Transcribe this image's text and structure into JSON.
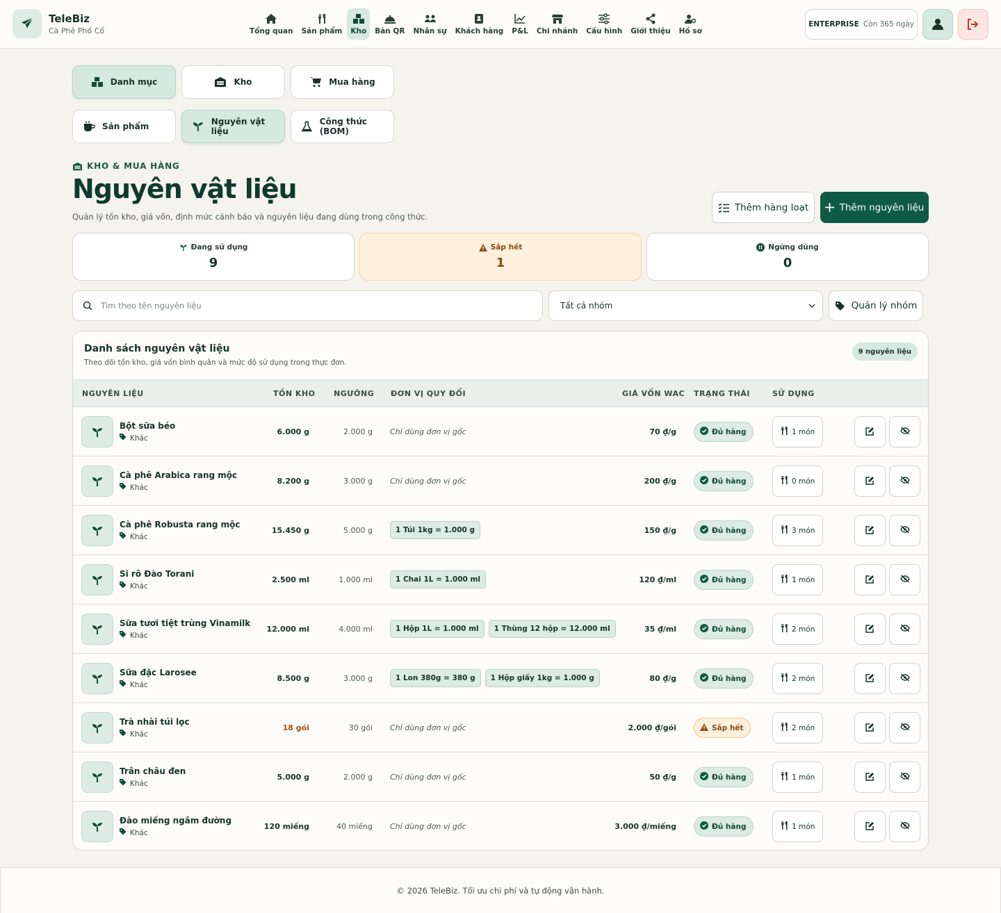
{
  "brand": {
    "name": "TeleBiz",
    "store": "Cà Phê Phố Cổ"
  },
  "nav": [
    {
      "label": "Tổng quan",
      "icon": "home-icon"
    },
    {
      "label": "Sản phẩm",
      "icon": "utensils-icon"
    },
    {
      "label": "Kho",
      "icon": "boxes-icon",
      "active": true
    },
    {
      "label": "Bàn QR",
      "icon": "cloche-icon"
    },
    {
      "label": "Nhân sự",
      "icon": "users-icon"
    },
    {
      "label": "Khách hàng",
      "icon": "contact-book-icon"
    },
    {
      "label": "P&L",
      "icon": "line-chart-icon"
    },
    {
      "label": "Chi nhánh",
      "icon": "store-icon"
    },
    {
      "label": "Cấu hình",
      "icon": "sliders-icon"
    },
    {
      "label": "Giới thiệu",
      "icon": "share-icon"
    },
    {
      "label": "Hồ sơ",
      "icon": "user-cog-icon"
    }
  ],
  "plan": {
    "name": "ENTERPRISE",
    "days": "Còn 365 ngày"
  },
  "tabs_main": [
    {
      "label": "Danh mục",
      "active": true
    },
    {
      "label": "Kho"
    },
    {
      "label": "Mua hàng"
    }
  ],
  "tabs_sub": [
    {
      "label": "Sản phẩm"
    },
    {
      "label": "Nguyên vật liệu",
      "active": true
    },
    {
      "label": "Công thức (BOM)"
    }
  ],
  "page": {
    "eyebrow": "KHO & MUA HÀNG",
    "title": "Nguyên vật liệu",
    "description": "Quản lý tồn kho, giá vốn, định mức cảnh báo và nguyên liệu đang dùng trong công thức.",
    "bulk_add_label": "Thêm hàng loạt",
    "add_label": "Thêm nguyên liệu"
  },
  "stats": [
    {
      "label": "Đang sử dụng",
      "value": "9"
    },
    {
      "label": "Sắp hết",
      "value": "1"
    },
    {
      "label": "Ngừng dùng",
      "value": "0"
    }
  ],
  "filters": {
    "search_placeholder": "Tìm theo tên nguyên liệu",
    "group_selected": "Tất cả nhóm",
    "manage_groups_label": "Quản lý nhóm"
  },
  "table": {
    "title": "Danh sách nguyên vật liệu",
    "subtitle": "Theo dõi tồn kho, giá vốn bình quân và mức độ sử dụng trong thực đơn.",
    "count_badge": "9 nguyên liệu",
    "headers": {
      "material": "NGUYÊN LIỆU",
      "stock": "TỒN KHO",
      "threshold": "NGƯỠNG",
      "conversion": "ĐƠN VỊ QUY ĐỔI",
      "cost": "GIÁ VỐN WAC",
      "status": "TRẠNG THÁI",
      "usage": "SỬ DỤNG"
    },
    "rows": [
      {
        "name": "Bột sữa béo",
        "group": "Khác",
        "stock": "6.000 g",
        "threshold": "2.000 g",
        "conversions": [],
        "no_conversion": "Chỉ dùng đơn vị gốc",
        "cost": "70 ₫/g",
        "status": "Đủ hàng",
        "status_type": "ok",
        "usage": "1 món"
      },
      {
        "name": "Cà phê Arabica rang mộc",
        "group": "Khác",
        "stock": "8.200 g",
        "threshold": "3.000 g",
        "conversions": [],
        "no_conversion": "Chỉ dùng đơn vị gốc",
        "cost": "200 ₫/g",
        "status": "Đủ hàng",
        "status_type": "ok",
        "usage": "0 món"
      },
      {
        "name": "Cà phê Robusta rang mộc",
        "group": "Khác",
        "stock": "15.450 g",
        "threshold": "5.000 g",
        "conversions": [
          "1 Túi 1kg = 1.000 g"
        ],
        "no_conversion": "",
        "cost": "150 ₫/g",
        "status": "Đủ hàng",
        "status_type": "ok",
        "usage": "3 món"
      },
      {
        "name": "Si rô Đào Torani",
        "group": "Khác",
        "stock": "2.500 ml",
        "threshold": "1.000 ml",
        "conversions": [
          "1 Chai 1L = 1.000 ml"
        ],
        "no_conversion": "",
        "cost": "120 ₫/ml",
        "status": "Đủ hàng",
        "status_type": "ok",
        "usage": "1 món"
      },
      {
        "name": "Sữa tươi tiệt trùng Vinamilk",
        "group": "Khác",
        "stock": "12.000 ml",
        "threshold": "4.000 ml",
        "conversions": [
          "1 Hộp 1L = 1.000 ml",
          "1 Thùng 12 hộp = 12.000 ml"
        ],
        "no_conversion": "",
        "cost": "35 ₫/ml",
        "status": "Đủ hàng",
        "status_type": "ok",
        "usage": "2 món"
      },
      {
        "name": "Sữa đặc Larosee",
        "group": "Khác",
        "stock": "8.500 g",
        "threshold": "3.000 g",
        "conversions": [
          "1 Lon 380g = 380 g",
          "1 Hộp giấy 1kg = 1.000 g"
        ],
        "no_conversion": "",
        "cost": "80 ₫/g",
        "status": "Đủ hàng",
        "status_type": "ok",
        "usage": "2 món"
      },
      {
        "name": "Trà nhài túi lọc",
        "group": "Khác",
        "stock": "18 gói",
        "stock_low": true,
        "threshold": "30 gói",
        "conversions": [],
        "no_conversion": "Chỉ dùng đơn vị gốc",
        "cost": "2.000 ₫/gói",
        "status": "Sắp hết",
        "status_type": "warn",
        "usage": "2 món"
      },
      {
        "name": "Trân châu đen",
        "group": "Khác",
        "stock": "5.000 g",
        "threshold": "2.000 g",
        "conversions": [],
        "no_conversion": "Chỉ dùng đơn vị gốc",
        "cost": "50 ₫/g",
        "status": "Đủ hàng",
        "status_type": "ok",
        "usage": "1 món"
      },
      {
        "name": "Đào miếng ngâm đường",
        "group": "Khác",
        "stock": "120 miếng",
        "threshold": "40 miếng",
        "conversions": [],
        "no_conversion": "Chỉ dùng đơn vị gốc",
        "cost": "3.000 ₫/miếng",
        "status": "Đủ hàng",
        "status_type": "ok",
        "usage": "1 món"
      }
    ]
  },
  "footer": {
    "text": "© 2026 TeleBiz. Tối ưu chi phí và tự động vận hành."
  },
  "colors": {
    "primary": "#0f5a43",
    "accent_bg": "#d6e9e1",
    "warn": "#8a4a0d",
    "warn_bg": "#fdf0dc",
    "danger": "#c0392b"
  }
}
